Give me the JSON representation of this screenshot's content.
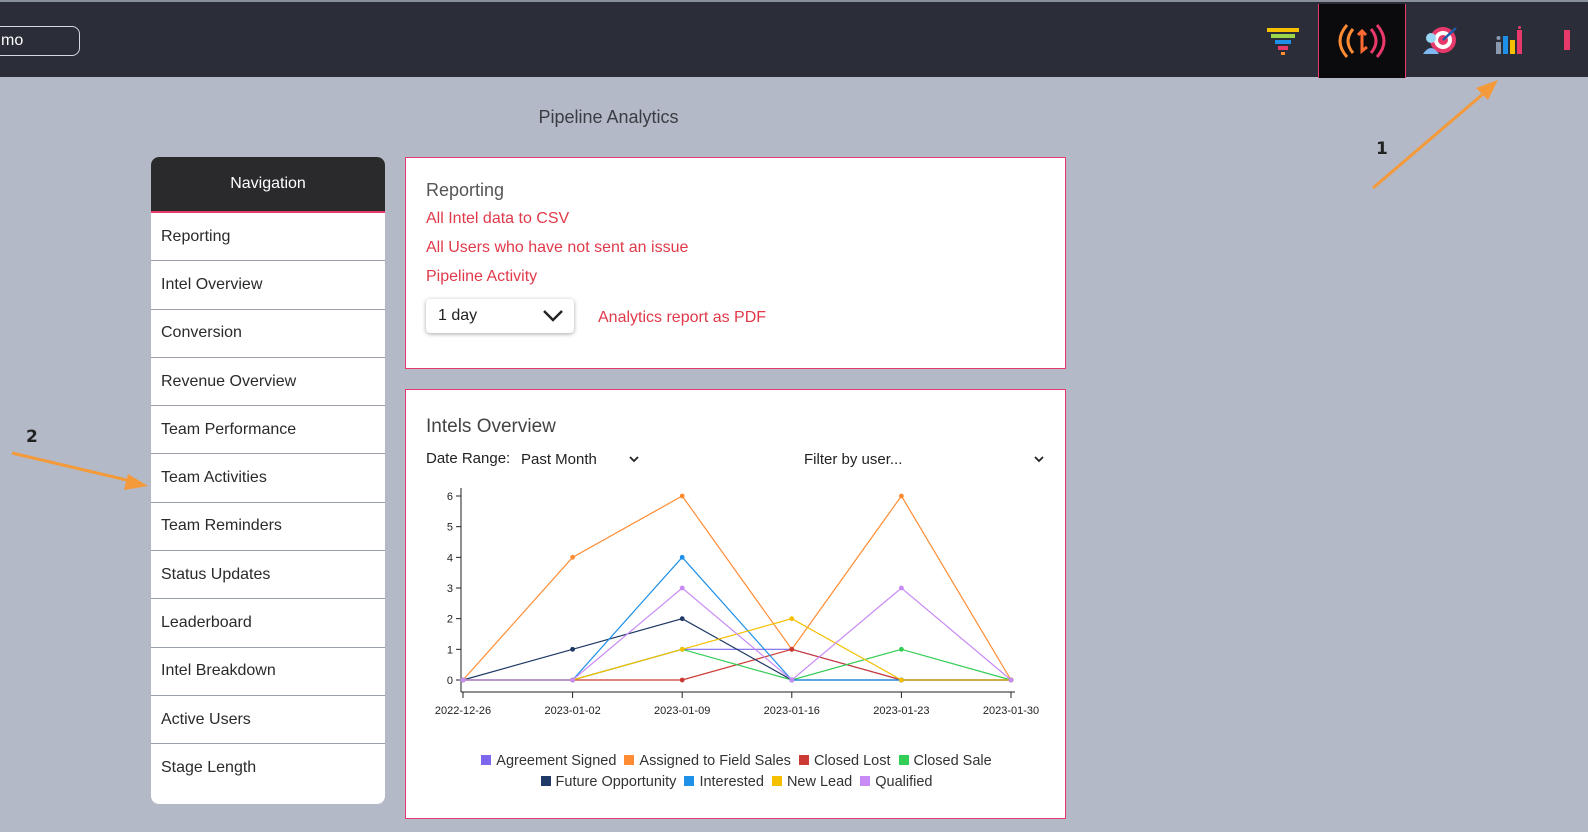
{
  "topbar": {
    "search_value": "mo",
    "icons": [
      "filter-funnel-icon",
      "signal-broadcast-icon",
      "target-user-icon",
      "bar-chart-icon"
    ],
    "colors": {
      "background": "#2b2e38",
      "active": "#0b0b0d",
      "accent": "#e73a6a"
    }
  },
  "page": {
    "title": "Pipeline Analytics"
  },
  "nav": {
    "header": "Navigation",
    "items": [
      "Reporting",
      "Intel Overview",
      "Conversion",
      "Revenue Overview",
      "Team Performance",
      "Team Activities",
      "Team Reminders",
      "Status Updates",
      "Leaderboard",
      "Intel Breakdown",
      "Active Users",
      "Stage Length"
    ]
  },
  "reporting": {
    "title": "Reporting",
    "links": [
      "All Intel data to CSV",
      "All Users who have not sent an issue",
      "Pipeline Activity"
    ],
    "period_select": "1 day",
    "pdf_link": "Analytics report as PDF"
  },
  "overview": {
    "title": "Intels Overview",
    "date_range_label": "Date Range:",
    "date_range_value": "Past Month",
    "user_filter_placeholder": "Filter by user..."
  },
  "chart_data": {
    "type": "line",
    "x": [
      "2022-12-26",
      "2023-01-02",
      "2023-01-09",
      "2023-01-16",
      "2023-01-23",
      "2023-01-30"
    ],
    "ylim": [
      0,
      6.6
    ],
    "yticks": [
      0,
      1,
      2,
      3,
      4,
      5,
      6
    ],
    "legend_position": "bottom",
    "series": [
      {
        "name": "Agreement Signed",
        "color": "#7b68ee",
        "values": [
          0,
          0,
          1,
          1,
          0,
          0
        ]
      },
      {
        "name": "Assigned to Field Sales",
        "color": "#ff8c33",
        "values": [
          0,
          4,
          6,
          1,
          6,
          0
        ]
      },
      {
        "name": "Closed Lost",
        "color": "#cc3b33",
        "values": [
          0,
          0,
          0,
          1,
          0,
          0
        ]
      },
      {
        "name": "Closed Sale",
        "color": "#33cc55",
        "values": [
          0,
          0,
          1,
          0,
          1,
          0
        ]
      },
      {
        "name": "Future Opportunity",
        "color": "#1f3a66",
        "values": [
          0,
          1,
          2,
          0,
          0,
          0
        ]
      },
      {
        "name": "Interested",
        "color": "#1e90e8",
        "values": [
          0,
          0,
          4,
          0,
          0,
          0
        ]
      },
      {
        "name": "New Lead",
        "color": "#f5c000",
        "values": [
          0,
          0,
          1,
          2,
          0,
          0
        ]
      },
      {
        "name": "Qualified",
        "color": "#c88af5",
        "values": [
          0,
          0,
          3,
          0,
          3,
          0
        ]
      }
    ]
  },
  "annotations": [
    "1",
    "2"
  ]
}
